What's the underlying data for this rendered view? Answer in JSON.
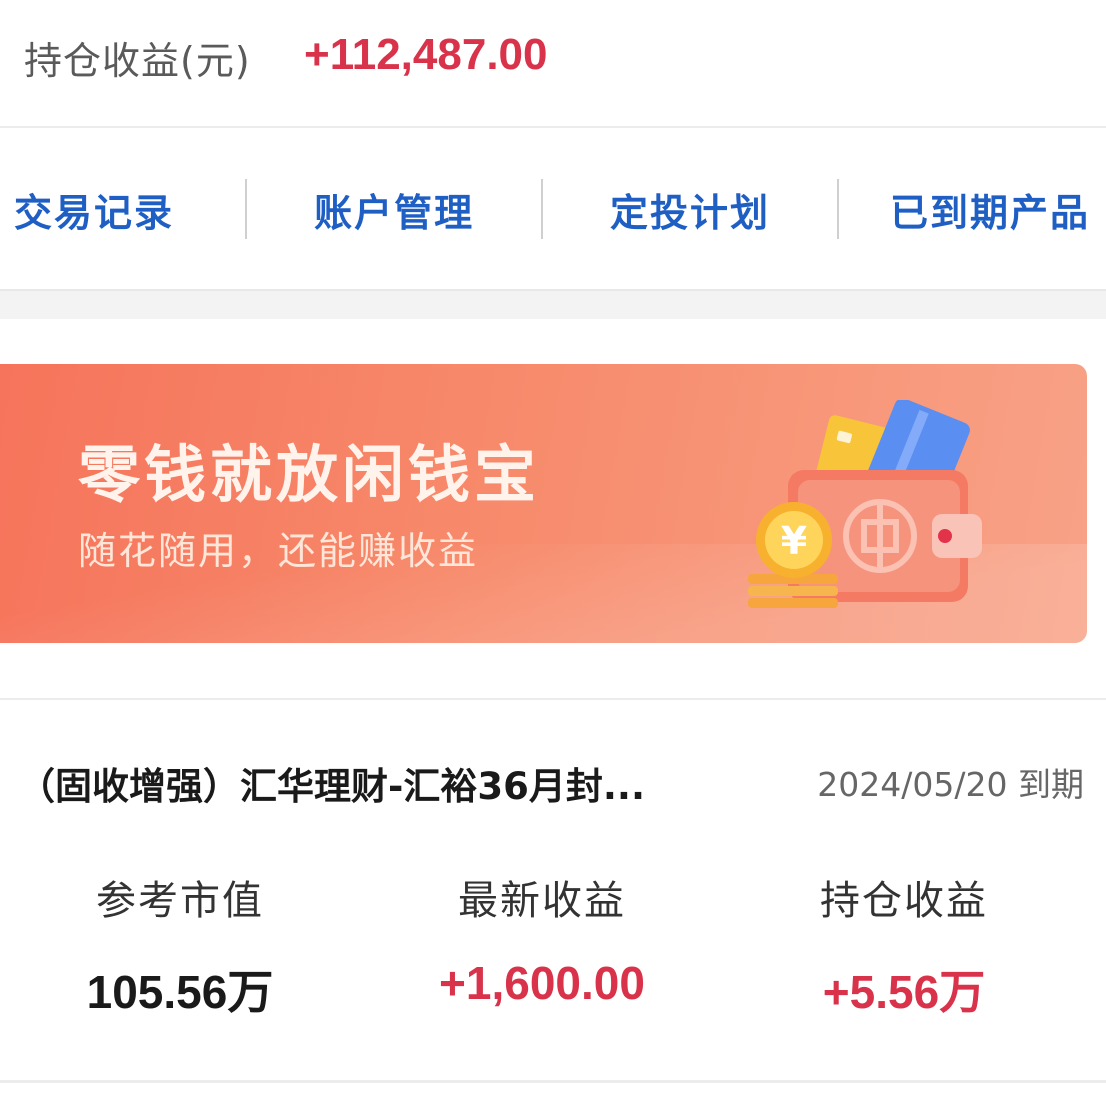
{
  "summary": {
    "label": "持仓收益(元)",
    "value": "+112,487.00"
  },
  "nav": {
    "items": [
      {
        "label": "交易记录"
      },
      {
        "label": "账户管理"
      },
      {
        "label": "定投计划"
      },
      {
        "label": "已到期产品"
      }
    ]
  },
  "banner": {
    "title": "零钱就放闲钱宝",
    "subtitle": "随花随用，还能赚收益",
    "coin_symbol": "¥",
    "icon": "wallet-icon"
  },
  "product": {
    "name": "（固收增强）汇华理财-汇裕36月封...",
    "maturity": "2024/05/20 到期",
    "stats": [
      {
        "label": "参考市值",
        "value": "105.56万"
      },
      {
        "label": "最新收益",
        "value": "+1,600.00"
      },
      {
        "label": "持仓收益",
        "value": "+5.56万"
      }
    ]
  },
  "colors": {
    "accent_red": "#d8334a",
    "nav_blue": "#1f5fc4",
    "banner": "#f6745b"
  }
}
